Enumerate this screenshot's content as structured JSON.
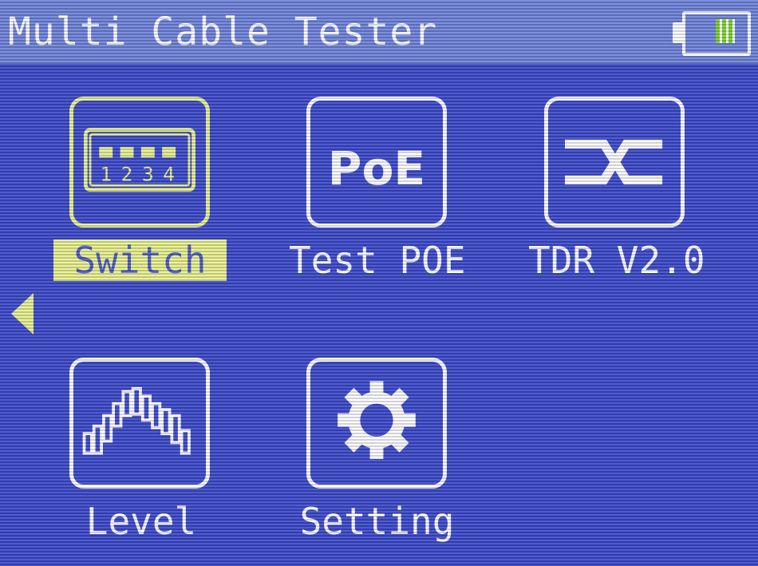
{
  "header": {
    "title": "Multi Cable Tester",
    "battery_icon": "battery-icon"
  },
  "menu": [
    {
      "id": "switch",
      "label": "Switch",
      "icon": "switch-ports-icon",
      "selected": true,
      "port_numbers": [
        "1",
        "2",
        "3",
        "4"
      ]
    },
    {
      "id": "test-poe",
      "label": "Test POE",
      "icon": "poe-icon",
      "icon_text": "PoE",
      "selected": false
    },
    {
      "id": "tdr",
      "label": "TDR V2.0",
      "icon": "tdr-cable-icon",
      "selected": false
    },
    {
      "id": "level",
      "label": "Level",
      "icon": "level-waveform-icon",
      "selected": false
    },
    {
      "id": "setting",
      "label": "Setting",
      "icon": "gear-icon",
      "selected": false
    }
  ],
  "nav": {
    "prev_icon": "left-arrow-icon"
  },
  "colors": {
    "background": "#3d4ac9",
    "header": "#6f83d8",
    "highlight": "#e9f28b",
    "battery_level": "#7ed321"
  }
}
